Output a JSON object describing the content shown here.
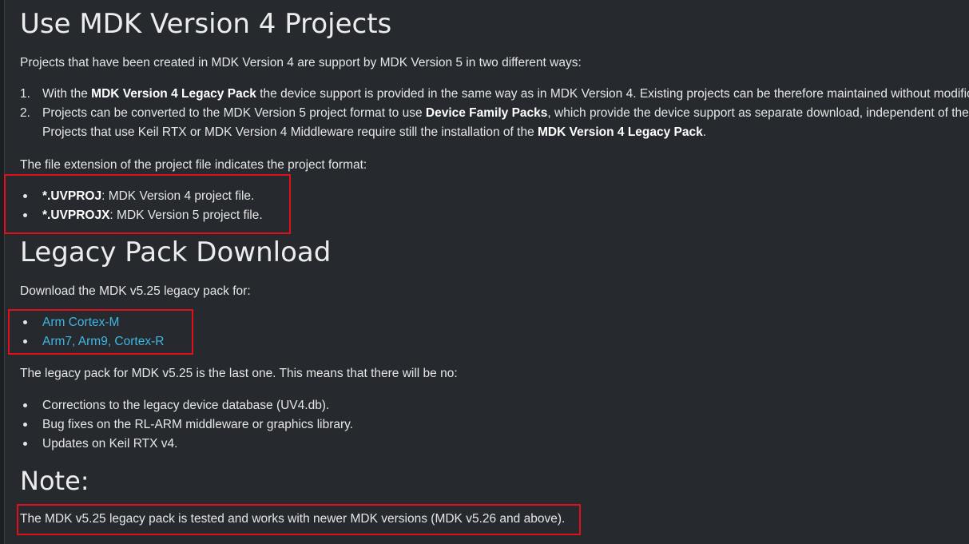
{
  "heading_main": "Use MDK Version 4 Projects",
  "intro": "Projects that have been created in MDK Version 4 are support by MDK Version 5 in two different ways:",
  "ways": [
    {
      "num": "1.",
      "pre": "With the ",
      "bold": "MDK Version 4 Legacy Pack",
      "post": " the device support is provided in the same way as in MDK Version 4. Existing projects can be therefore maintained without modific"
    },
    {
      "num": "2.",
      "pre": "Projects can be converted to the MDK Version 5 project format to use ",
      "bold": "Device Family Packs",
      "post": ", which provide the device support as separate download, independent of the",
      "line2_pre": "Projects that use Keil RTX or MDK Version 4 Middleware require still the installation of the ",
      "line2_bold": "MDK Version 4 Legacy Pack",
      "line2_post": "."
    }
  ],
  "ext_intro": "The file extension of the project file indicates the project format:",
  "extensions": [
    {
      "ext": "*.UVPROJ",
      "desc": ": MDK Version 4 project file."
    },
    {
      "ext": "*.UVPROJX",
      "desc": ": MDK Version 5 project file."
    }
  ],
  "heading_legacy": "Legacy Pack Download",
  "download_intro": "Download the MDK v5.25 legacy pack for:",
  "download_links": [
    "Arm Cortex-M",
    "Arm7, Arm9, Cortex-R"
  ],
  "last_intro": "The legacy pack for MDK v5.25 is the last one. This means that there will be no:",
  "no_more": [
    "Corrections to the legacy device database (UV4.db).",
    "Bug fixes on the RL-ARM middleware or graphics library.",
    "Updates on Keil RTX v4."
  ],
  "heading_note": "Note:",
  "note_text": "The MDK v5.25 legacy pack is tested and works with newer MDK versions (MDK v5.26 and above).",
  "colors": {
    "background": "#262a2e",
    "text": "#e6e6e6",
    "link": "#3fb5e0",
    "highlight_box": "#e0101b"
  }
}
